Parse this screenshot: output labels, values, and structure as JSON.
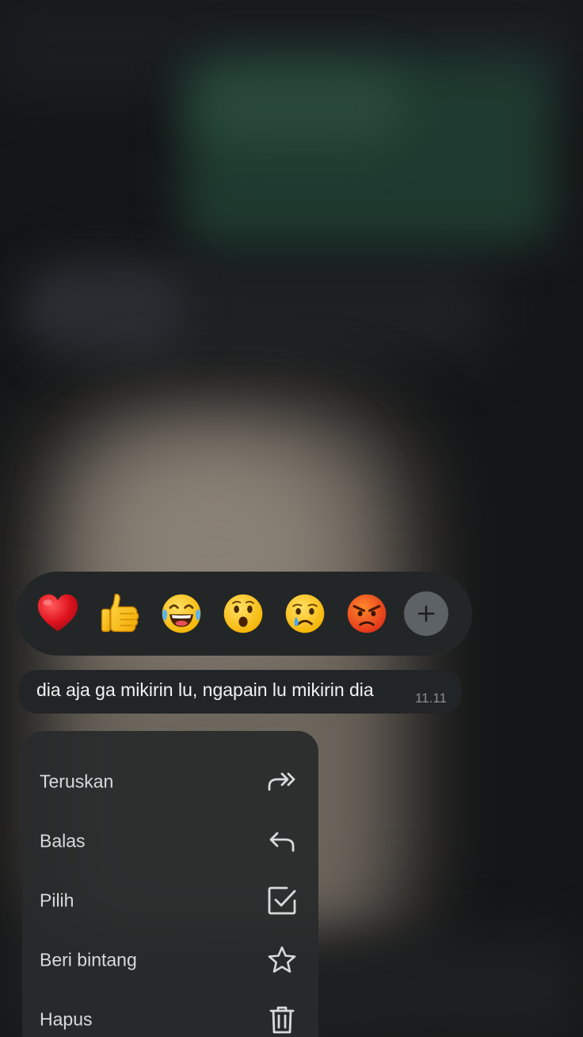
{
  "reactions": {
    "items": [
      {
        "name": "heart",
        "glyph": "❤️"
      },
      {
        "name": "thumbs-up",
        "glyph": "👍"
      },
      {
        "name": "laughing",
        "glyph": "😂"
      },
      {
        "name": "surprised",
        "glyph": "😮"
      },
      {
        "name": "crying",
        "glyph": "😢"
      },
      {
        "name": "angry",
        "glyph": "😡"
      }
    ],
    "more_icon": "plus-icon"
  },
  "message": {
    "text": "dia aja ga mikirin lu, ngapain lu mikirin dia",
    "time": "11.11"
  },
  "menu": {
    "items": [
      {
        "label": "Teruskan",
        "icon": "forward-icon"
      },
      {
        "label": "Balas",
        "icon": "reply-icon"
      },
      {
        "label": "Pilih",
        "icon": "checkbox-icon"
      },
      {
        "label": "Beri bintang",
        "icon": "star-icon"
      },
      {
        "label": "Hapus",
        "icon": "trash-icon"
      }
    ]
  },
  "colors": {
    "background": "#151617",
    "surface": "#232627",
    "menu_surface": "#282a2b",
    "text_primary": "#f2f2f2",
    "text_secondary": "#8a8e91",
    "plus_button": "#5d6266"
  }
}
